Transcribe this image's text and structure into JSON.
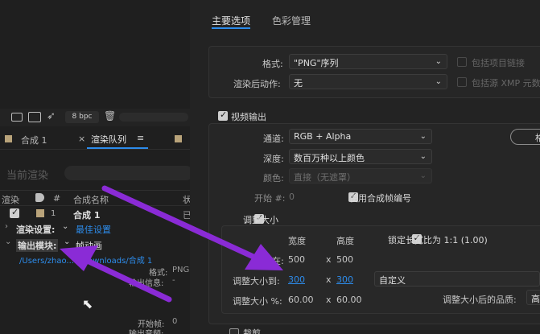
{
  "left": {
    "toolbar": {
      "bpc": "8 bpc"
    },
    "tabs": [
      {
        "label": "合成 1"
      },
      {
        "label": "渲染队列",
        "close": "×",
        "menu": "≡"
      }
    ],
    "current_render": "当前渲染",
    "columns": {
      "render": "渲染",
      "tag": "🏷",
      "num": "#",
      "comp_name": "合成名称",
      "status": "状"
    },
    "row": {
      "num": "1",
      "name": "合成 1",
      "status": "已"
    },
    "render_settings": {
      "label": "渲染设置:",
      "value": "最佳设置"
    },
    "output_module": {
      "label": "输出模块:",
      "value": "帧动画"
    },
    "path": "/Users/zhao...o/Downloads/合成 1",
    "format_label": "格式:",
    "format_value": "PNG",
    "output_info_label": "输出信息:",
    "output_info_value": "-",
    "start_frame_label": "开始帧:",
    "start_frame_value": "0",
    "output_audio_label": "输出音频:"
  },
  "right": {
    "tabs": [
      "主要选项",
      "色彩管理"
    ],
    "format": {
      "label": "格式:",
      "value": "\"PNG\"序列"
    },
    "post_render": {
      "label": "渲染后动作:",
      "value": "无"
    },
    "include_project_link": "包括项目链接",
    "include_xmp": "包括源 XMP 元数",
    "video_output": "视频输出",
    "channels": {
      "label": "通道:",
      "value": "RGB + Alpha"
    },
    "depth": {
      "label": "深度:",
      "value": "数百万种以上颜色"
    },
    "color": {
      "label": "颜色:",
      "value": "直接（无遮罩）"
    },
    "start": {
      "label": "开始 #:",
      "value": "0"
    },
    "use_comp_frame": "使用合成帧编号",
    "format_options_btn": "格",
    "resize": "调整大小",
    "width_h": "宽度",
    "height_h": "高度",
    "lock_ratio": "锁定长宽比为 1:1 (1.00)",
    "render_at": {
      "label": "渲染在:",
      "w": "500",
      "x": "x",
      "h": "500"
    },
    "resize_to": {
      "label": "调整大小到:",
      "w": "300",
      "x": "x",
      "h": "300",
      "preset": "自定义"
    },
    "resize_pct": {
      "label": "调整大小 %:",
      "w": "60.00",
      "x": "x",
      "h": "60.00"
    },
    "quality_label": "调整大小后的品质:",
    "quality_value": "高",
    "crop": "裁剪"
  }
}
